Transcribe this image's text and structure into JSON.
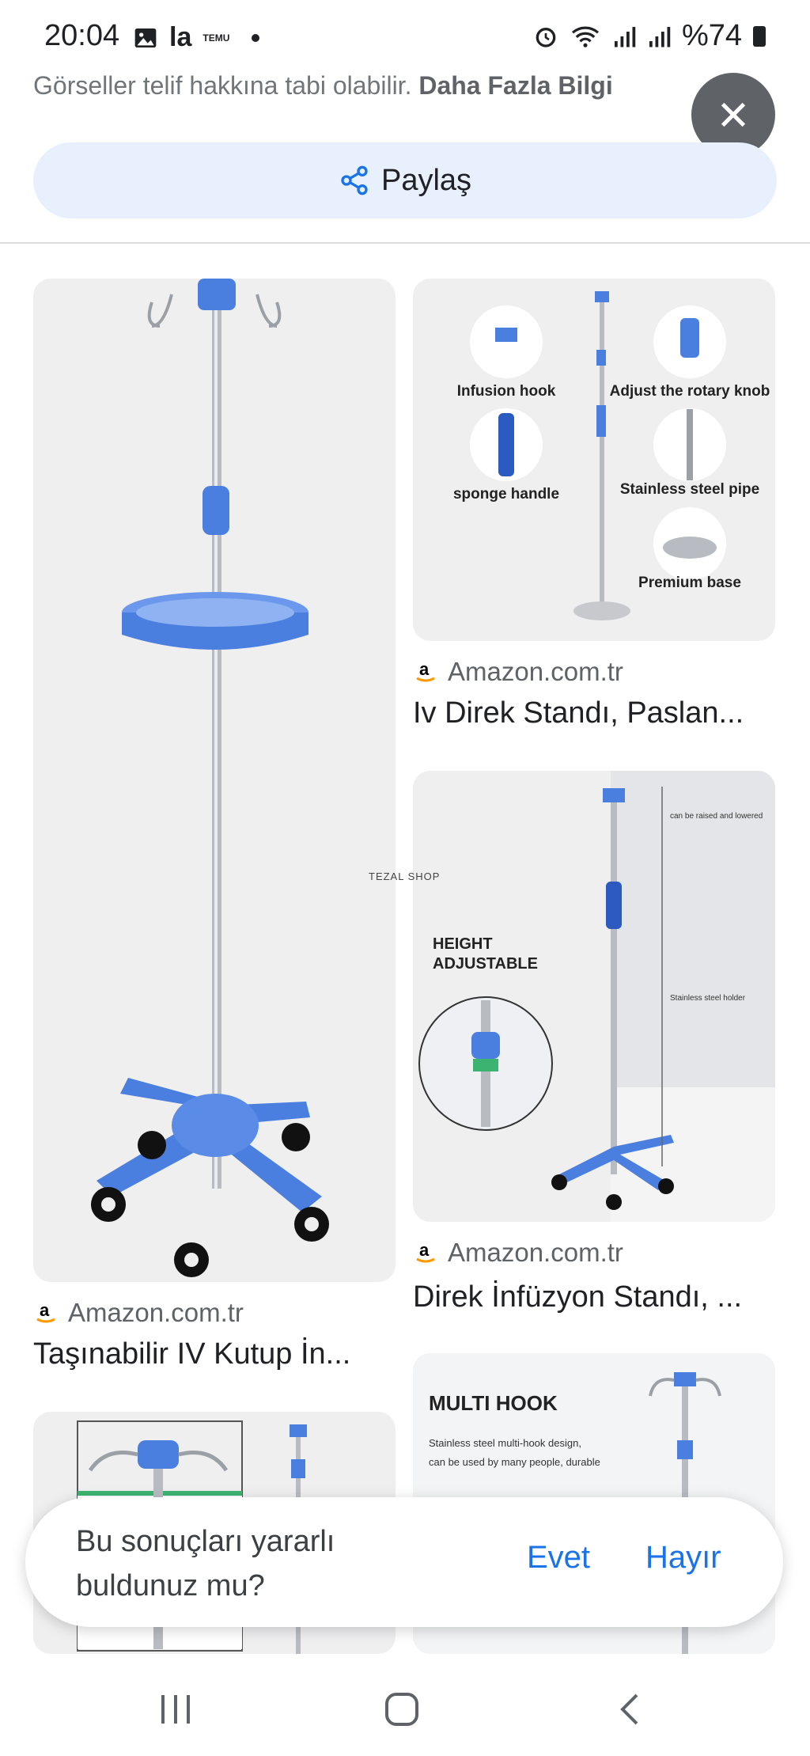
{
  "status_bar": {
    "time": "20:04",
    "left_icons": [
      "image-icon",
      "la-app-icon",
      "temu-icon",
      "notification-dot"
    ],
    "right_icons": [
      "alarm-icon",
      "wifi-icon",
      "signal-icon",
      "signal-icon",
      "battery-icon"
    ],
    "battery": "%74",
    "temu_label": "TEMU"
  },
  "notice": {
    "text": "Görseller telif hakkına tabi olabilir.",
    "link": "Daha Fazla Bilgi"
  },
  "share": {
    "label": "Paylaş"
  },
  "results": [
    {
      "source": "Amazon.com.tr",
      "title": "Taşınabilir IV Kutup İn...",
      "image_alt": "blue-iv-pole-with-wheels"
    },
    {
      "source": "Amazon.com.tr",
      "title": "Iv Direk Standı, Paslan...",
      "image_labels": [
        "Infusion hook",
        "Adjust the rotary knob",
        "sponge handle",
        "Stainless steel pipe",
        "Premium base"
      ]
    },
    {
      "source": "Amazon.com.tr",
      "title": "Direk İnfüzyon Standı, ...",
      "image_labels": [
        "HEIGHT",
        "ADJUSTABLE",
        "can be raised and lowered",
        "Stainless steel holder"
      ]
    },
    {
      "image_labels": [
        "MULTI HOOK",
        "Stainless steel multi-hook design,",
        "can be used by many people, durable"
      ]
    }
  ],
  "watermark": "TEZAL SHOP",
  "feedback": {
    "question": "Bu sonuçları yararlı buldunuz mu?",
    "yes": "Evet",
    "no": "Hayır"
  },
  "colors": {
    "accent": "#1a73e8",
    "share_bg": "#e8f0fe",
    "iv_blue": "#4a7fe0"
  }
}
